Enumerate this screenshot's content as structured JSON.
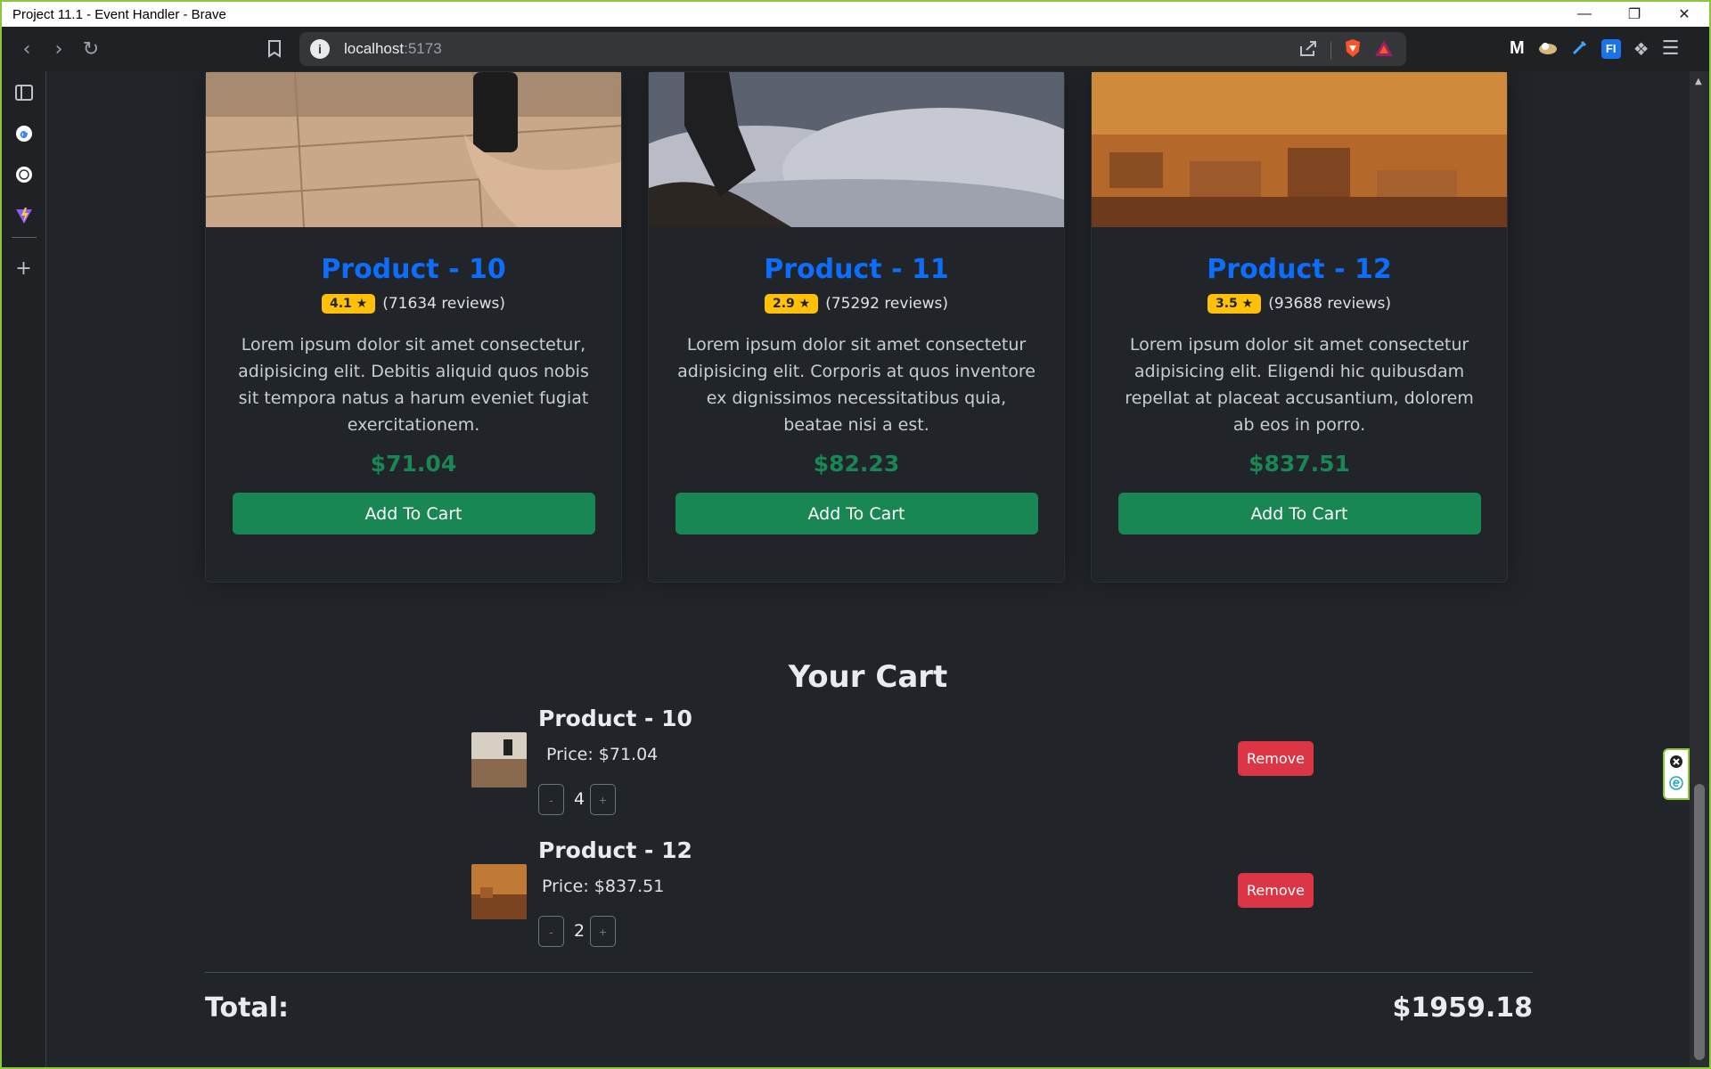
{
  "window": {
    "title": "Project 11.1 - Event Handler - Brave"
  },
  "url": {
    "host": "localhost",
    "port": ":5173"
  },
  "products": [
    {
      "name": "Product - 10",
      "rating": "4.1 ★",
      "reviews": "(71634 reviews)",
      "description": "Lorem ipsum dolor sit amet consectetur, adipisicing elit. Debitis aliquid quos nobis sit tempora natus a harum eveniet fugiat exercitationem.",
      "price": "$71.04",
      "button": "Add To Cart"
    },
    {
      "name": "Product - 11",
      "rating": "2.9 ★",
      "reviews": "(75292 reviews)",
      "description": "Lorem ipsum dolor sit amet consectetur adipisicing elit. Corporis at quos inventore ex dignissimos necessitatibus quia, beatae nisi a est.",
      "price": "$82.23",
      "button": "Add To Cart"
    },
    {
      "name": "Product - 12",
      "rating": "3.5 ★",
      "reviews": "(93688 reviews)",
      "description": "Lorem ipsum dolor sit amet consectetur adipisicing elit. Eligendi hic quibusdam repellat at placeat accusantium, dolorem ab eos in porro.",
      "price": "$837.51",
      "button": "Add To Cart"
    }
  ],
  "cart": {
    "title": "Your Cart",
    "items": [
      {
        "name": "Product - 10",
        "price": "Price: $71.04",
        "quantity": "4",
        "minus": "-",
        "plus": "+",
        "remove": "Remove"
      },
      {
        "name": "Product - 12",
        "price": "Price: $837.51",
        "quantity": "2",
        "minus": "-",
        "plus": "+",
        "remove": "Remove"
      }
    ],
    "total_label": "Total:",
    "total_value": "$1959.18"
  },
  "colors": {
    "accent_blue": "#0d6efd",
    "success_green": "#198754",
    "danger_red": "#dc3545",
    "warning_yellow": "#ffc107",
    "page_bg": "#212529"
  }
}
